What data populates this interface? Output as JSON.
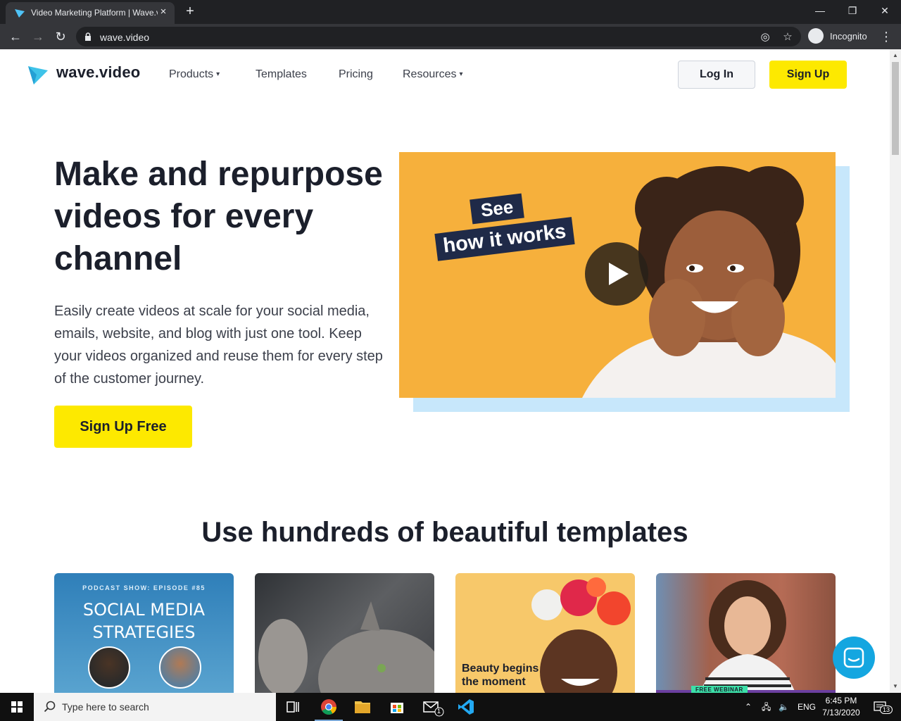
{
  "browser": {
    "tab_title": "Video Marketing Platform | Wave.video",
    "new_tab_glyph": "+",
    "url": "wave.video",
    "profile_label": "Incognito",
    "icons": [
      "back-icon",
      "forward-icon",
      "reload-icon",
      "lock-icon",
      "eye-off-icon",
      "star-icon",
      "incognito-icon",
      "more-vert-icon",
      "minimize-icon",
      "restore-icon",
      "close-icon"
    ]
  },
  "site": {
    "logo_text": "wave.video",
    "nav": [
      {
        "label": "Products",
        "has_dropdown": true
      },
      {
        "label": "Templates",
        "has_dropdown": false
      },
      {
        "label": "Pricing",
        "has_dropdown": false
      },
      {
        "label": "Resources",
        "has_dropdown": true
      }
    ],
    "login_label": "Log In",
    "signup_label": "Sign Up"
  },
  "hero": {
    "title": "Make and repurpose videos for every channel",
    "description": "Easily create videos at scale for your social media, emails, website, and blog with just one tool. Keep your videos organized and reuse them for every step of the customer journey.",
    "cta_label": "Sign Up Free",
    "video_caption_line1": "See",
    "video_caption_line2": "how it works"
  },
  "templates": {
    "heading": "Use hundreds of beautiful templates",
    "cards": [
      {
        "eyebrow": "PODCAST SHOW: EPISODE #85",
        "title_line1": "SOCIAL MEDIA",
        "title_line2": "STRATEGIES"
      },
      {},
      {
        "text_line1": "Beauty begins",
        "text_line2": "the moment"
      },
      {
        "badge": "FREE WEBINAR"
      }
    ]
  },
  "taskbar": {
    "search_placeholder": "Type here to search",
    "language": "ENG",
    "time": "6:45 PM",
    "date": "7/13/2020",
    "mail_badge": "1",
    "notification_count": "13"
  },
  "colors": {
    "brand_yellow": "#fde900",
    "video_bg": "#f6b03c",
    "video_shadow": "#c7e7fb",
    "chat_blue": "#14a6e0"
  }
}
